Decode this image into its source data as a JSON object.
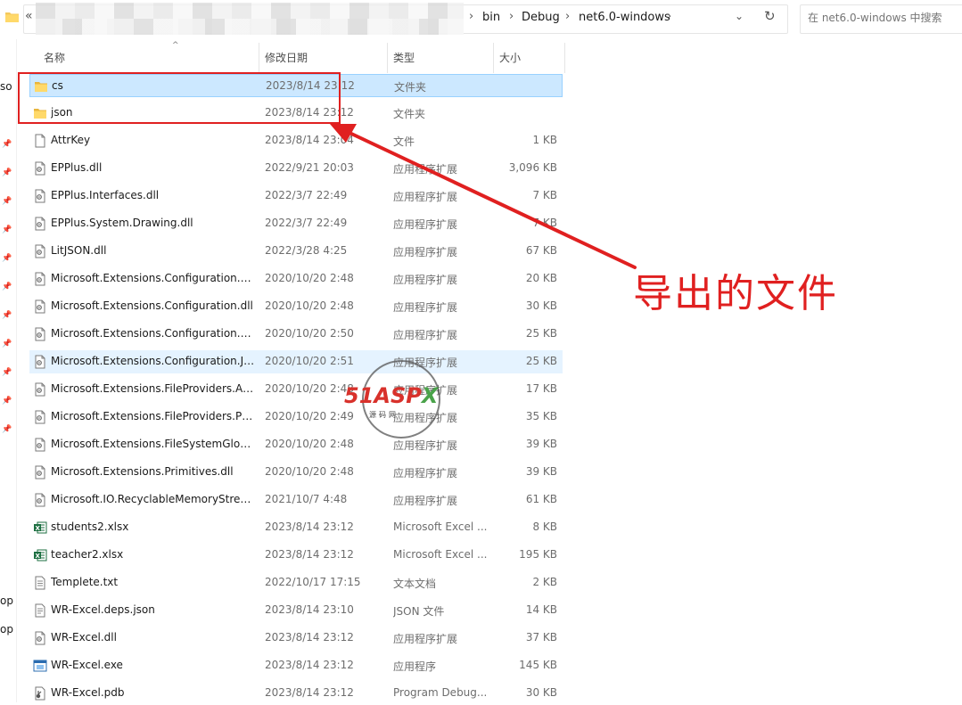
{
  "address": {
    "crumbs": [
      "bin",
      "Debug",
      "net6.0-windows"
    ],
    "back_glyph": "«",
    "search_placeholder": "在 net6.0-windows 中搜索"
  },
  "nav": {
    "labels": [
      "so",
      "op",
      "op"
    ]
  },
  "columns": {
    "name": "名称",
    "date": "修改日期",
    "type": "类型",
    "size": "大小"
  },
  "files": [
    {
      "name": "cs",
      "date": "2023/8/14 23:12",
      "type": "文件夹",
      "size": "",
      "icon": "folder-icon"
    },
    {
      "name": "json",
      "date": "2023/8/14 23:12",
      "type": "文件夹",
      "size": "",
      "icon": "folder-icon"
    },
    {
      "name": "AttrKey",
      "date": "2023/8/14 23:04",
      "type": "文件",
      "size": "1 KB",
      "icon": "file-icon"
    },
    {
      "name": "EPPlus.dll",
      "date": "2022/9/21 20:03",
      "type": "应用程序扩展",
      "size": "3,096 KB",
      "icon": "dll-icon"
    },
    {
      "name": "EPPlus.Interfaces.dll",
      "date": "2022/3/7 22:49",
      "type": "应用程序扩展",
      "size": "7 KB",
      "icon": "dll-icon"
    },
    {
      "name": "EPPlus.System.Drawing.dll",
      "date": "2022/3/7 22:49",
      "type": "应用程序扩展",
      "size": "7 KB",
      "icon": "dll-icon"
    },
    {
      "name": "LitJSON.dll",
      "date": "2022/3/28 4:25",
      "type": "应用程序扩展",
      "size": "67 KB",
      "icon": "dll-icon"
    },
    {
      "name": "Microsoft.Extensions.Configuration.A...",
      "date": "2020/10/20 2:48",
      "type": "应用程序扩展",
      "size": "20 KB",
      "icon": "dll-icon"
    },
    {
      "name": "Microsoft.Extensions.Configuration.dll",
      "date": "2020/10/20 2:48",
      "type": "应用程序扩展",
      "size": "30 KB",
      "icon": "dll-icon"
    },
    {
      "name": "Microsoft.Extensions.Configuration.Fil...",
      "date": "2020/10/20 2:50",
      "type": "应用程序扩展",
      "size": "25 KB",
      "icon": "dll-icon"
    },
    {
      "name": "Microsoft.Extensions.Configuration.Js...",
      "date": "2020/10/20 2:51",
      "type": "应用程序扩展",
      "size": "25 KB",
      "icon": "dll-icon"
    },
    {
      "name": "Microsoft.Extensions.FileProviders.Ab...",
      "date": "2020/10/20 2:48",
      "type": "应用程序扩展",
      "size": "17 KB",
      "icon": "dll-icon"
    },
    {
      "name": "Microsoft.Extensions.FileProviders.Ph...",
      "date": "2020/10/20 2:49",
      "type": "应用程序扩展",
      "size": "35 KB",
      "icon": "dll-icon"
    },
    {
      "name": "Microsoft.Extensions.FileSystemGlob...",
      "date": "2020/10/20 2:48",
      "type": "应用程序扩展",
      "size": "39 KB",
      "icon": "dll-icon"
    },
    {
      "name": "Microsoft.Extensions.Primitives.dll",
      "date": "2020/10/20 2:48",
      "type": "应用程序扩展",
      "size": "39 KB",
      "icon": "dll-icon"
    },
    {
      "name": "Microsoft.IO.RecyclableMemoryStrea...",
      "date": "2021/10/7 4:48",
      "type": "应用程序扩展",
      "size": "61 KB",
      "icon": "dll-icon"
    },
    {
      "name": "students2.xlsx",
      "date": "2023/8/14 23:12",
      "type": "Microsoft Excel ...",
      "size": "8 KB",
      "icon": "excel-icon"
    },
    {
      "name": "teacher2.xlsx",
      "date": "2023/8/14 23:12",
      "type": "Microsoft Excel ...",
      "size": "195 KB",
      "icon": "excel-icon"
    },
    {
      "name": "Templete.txt",
      "date": "2022/10/17 17:15",
      "type": "文本文档",
      "size": "2 KB",
      "icon": "text-file-icon"
    },
    {
      "name": "WR-Excel.deps.json",
      "date": "2023/8/14 23:10",
      "type": "JSON 文件",
      "size": "14 KB",
      "icon": "json-file-icon"
    },
    {
      "name": "WR-Excel.dll",
      "date": "2023/8/14 23:12",
      "type": "应用程序扩展",
      "size": "37 KB",
      "icon": "dll-icon"
    },
    {
      "name": "WR-Excel.exe",
      "date": "2023/8/14 23:12",
      "type": "应用程序",
      "size": "145 KB",
      "icon": "exe-icon"
    },
    {
      "name": "WR-Excel.pdb",
      "date": "2023/8/14 23:12",
      "type": "Program Debug...",
      "size": "30 KB",
      "icon": "pdb-icon"
    }
  ],
  "selected_index": 0,
  "hover_index": 10,
  "annotation": {
    "text": "导出的文件",
    "color": "#e02020"
  },
  "watermark": {
    "main_a": "51ASP",
    "main_b": "X",
    "sub": "源码网"
  },
  "colors": {
    "selected_bg": "#cce8ff",
    "hover_bg": "#e5f3ff",
    "folder": "#f4c95d",
    "excel": "#1d6f42"
  }
}
